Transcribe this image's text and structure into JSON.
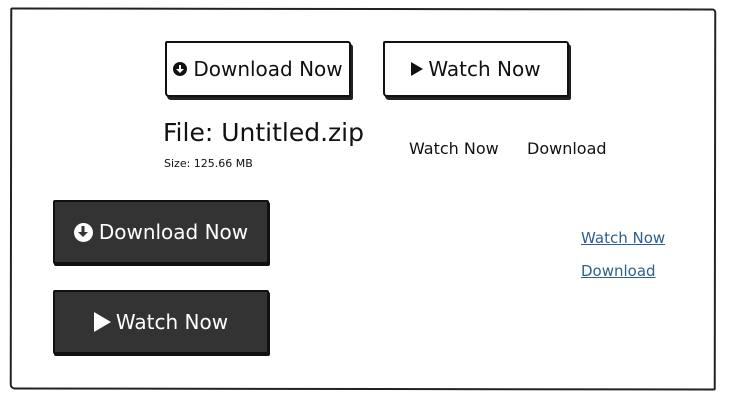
{
  "buttons": {
    "download_outline": "Download Now",
    "watch_outline": "Watch Now",
    "download_dark": "Download Now",
    "watch_dark": "Watch Now"
  },
  "file": {
    "title": "File: Untitled.zip",
    "size": "Size: 125.66 MB"
  },
  "links": {
    "plain_watch": "Watch Now",
    "plain_download": "Download",
    "underlined_watch": "Watch Now",
    "underlined_download": "Download"
  },
  "icons": {
    "download": "download-circle-icon",
    "watch": "play-icon"
  },
  "colors": {
    "dark_button": "#333333",
    "link": "#2f5f91",
    "border": "#111111"
  }
}
